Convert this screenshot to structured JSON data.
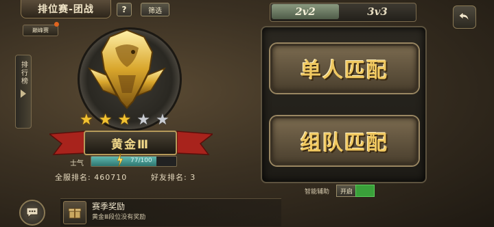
{
  "header": {
    "title": "排位赛-团战",
    "help_label": "?",
    "filter_label": "筛选",
    "peak_label": "巅峰赛"
  },
  "sidebar": {
    "leaderboard_label": "排行榜"
  },
  "player": {
    "stars_filled": 3,
    "stars_total": 5,
    "rank_name": "黄金Ⅲ",
    "morale_label": "士气",
    "morale_text": "77/100",
    "morale_value": 77,
    "morale_max": 100,
    "server_rank": "全服排名: 460710",
    "friend_rank": "好友排名: 3"
  },
  "reward": {
    "title": "赛季奖励",
    "subtitle": "黄金Ⅲ段位没有奖励"
  },
  "modes": {
    "tab_2v2": "2v2",
    "tab_3v3": "3v3",
    "selected": "2v2",
    "solo_label": "单人匹配",
    "team_label": "组队匹配"
  },
  "assist": {
    "label": "智能辅助",
    "on_label": "开启",
    "enabled": true
  },
  "colors": {
    "gold": "#f2c230",
    "accent_green": "#3aa03a",
    "morale": "#2e7670"
  }
}
